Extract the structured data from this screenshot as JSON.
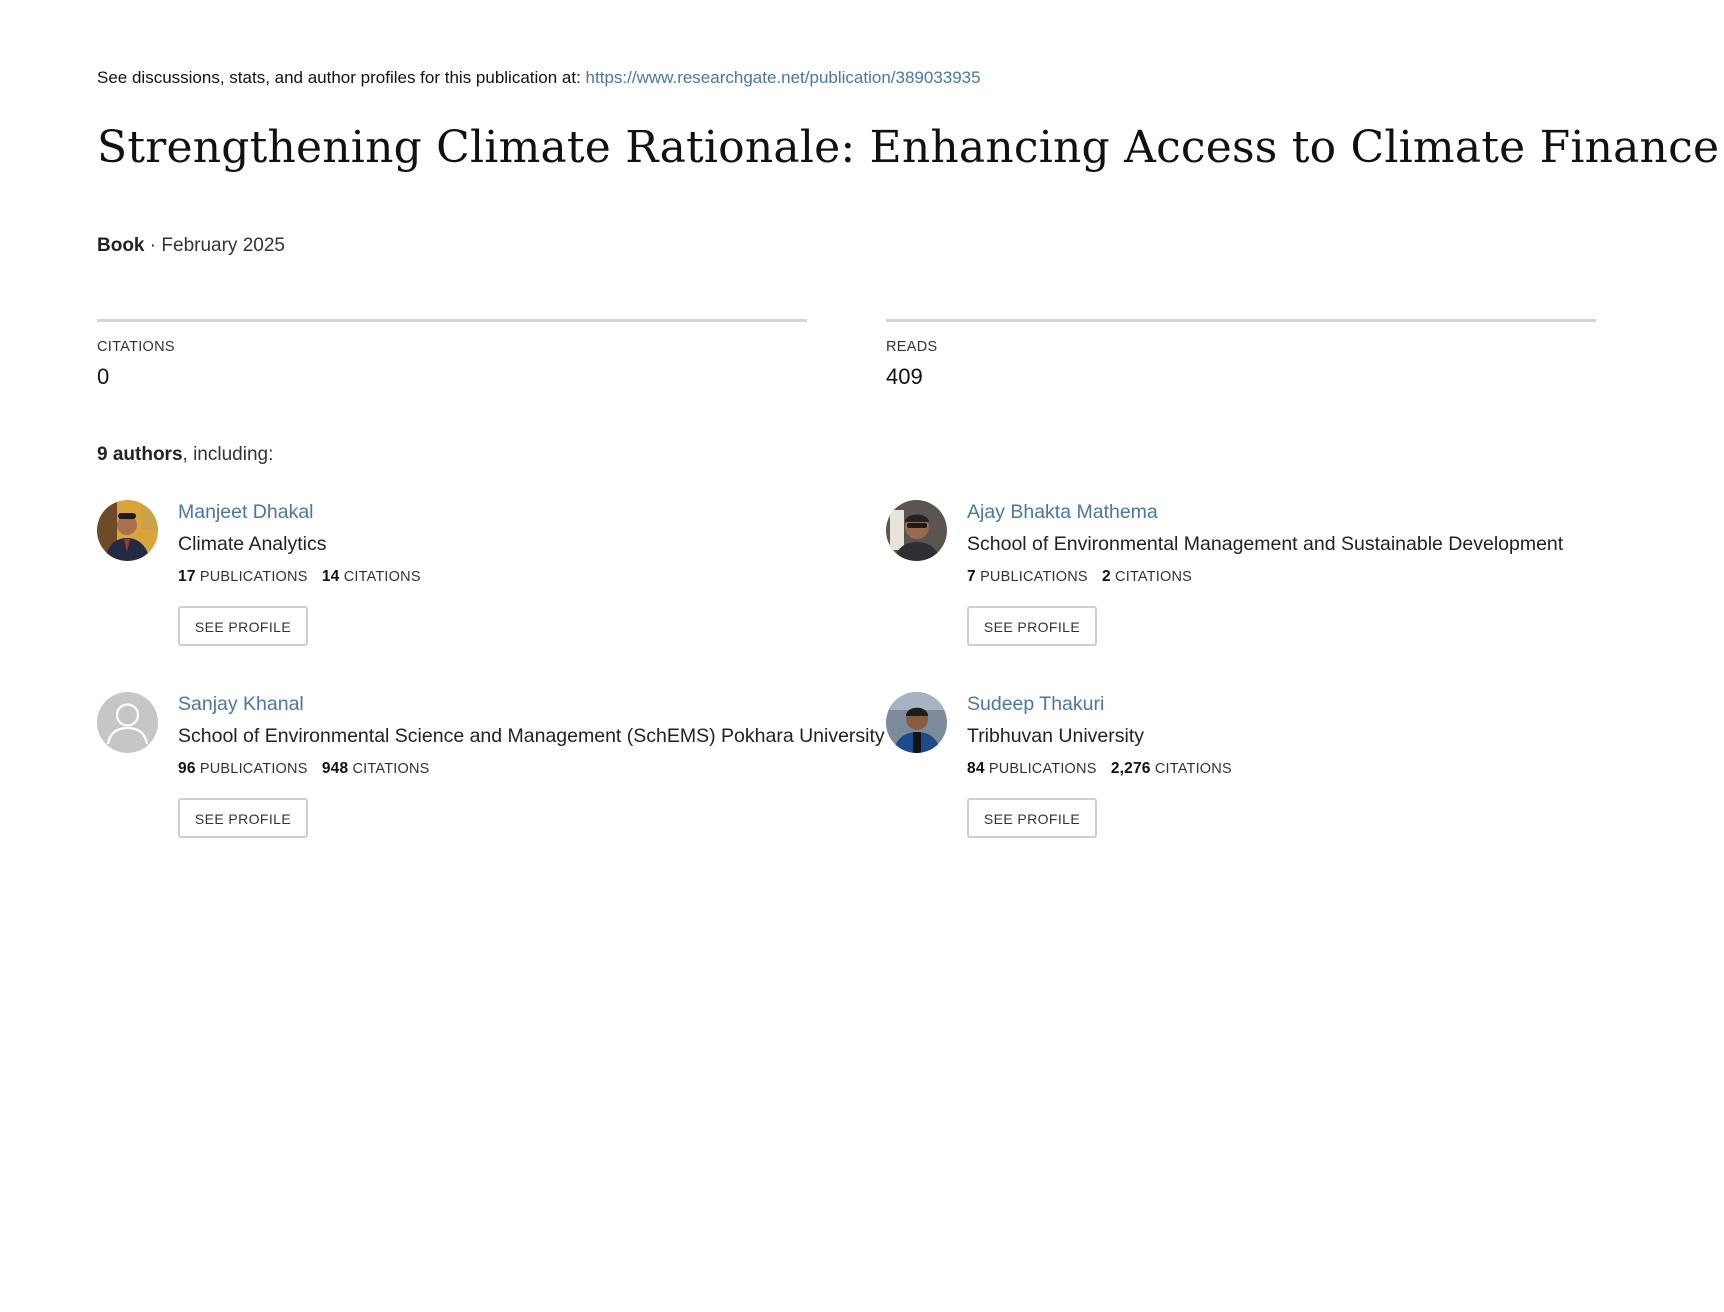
{
  "header": {
    "discussion_text": "See discussions, stats, and author profiles for this publication at: ",
    "publication_url": "https://www.researchgate.net/publication/389033935"
  },
  "publication": {
    "title": "Strengthening Climate Rationale: Enhancing Access to Climate Finance",
    "type": "Book",
    "separator": " · ",
    "date": "February 2025"
  },
  "stats": {
    "citations_label": "CITATIONS",
    "citations_value": "0",
    "reads_label": "READS",
    "reads_value": "409"
  },
  "authors_section": {
    "count_label": "9 authors",
    "suffix": ", including:"
  },
  "authors": [
    {
      "name": "Manjeet Dhakal",
      "institution": "Climate Analytics",
      "publications": "17",
      "citations": "14",
      "avatar": "photo-avatar-icon"
    },
    {
      "name": "Ajay Bhakta Mathema",
      "institution": "School of Environmental Management and Sustainable Development",
      "publications": "7",
      "citations": "2",
      "avatar": "photo-avatar-icon"
    },
    {
      "name": "Sanjay Khanal",
      "institution": "School of Environmental Science and Management (SchEMS) Pokhara University",
      "publications": "96",
      "citations": "948",
      "avatar": "default-user-icon"
    },
    {
      "name": "Sudeep Thakuri",
      "institution": "Tribhuvan University",
      "publications": "84",
      "citations": "2,276",
      "avatar": "photo-avatar-icon"
    }
  ],
  "labels": {
    "publications": "PUBLICATIONS",
    "citations": "CITATIONS",
    "see_profile": "SEE PROFILE"
  },
  "colors": {
    "link": "#4a76a8",
    "divider": "#d4d4d4",
    "button_border": "#cfcfcf"
  }
}
